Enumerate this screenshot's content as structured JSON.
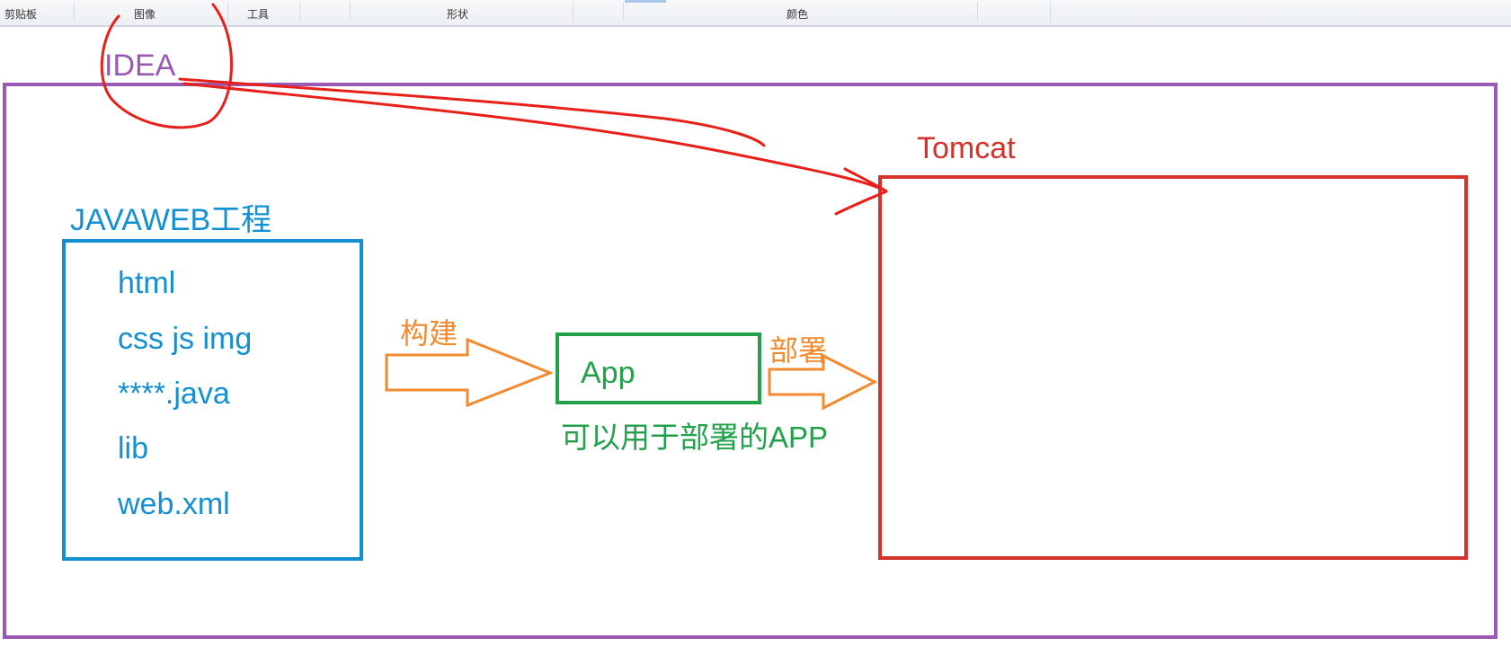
{
  "toolbar": {
    "groups": [
      {
        "label": "剪贴板"
      },
      {
        "label": "图像"
      },
      {
        "label": "工具"
      },
      {
        "label": "形状"
      },
      {
        "label": "颜色"
      }
    ]
  },
  "diagram": {
    "ide_label": "IDEA",
    "server_label": "Tomcat",
    "project": {
      "title": "JAVAWEB工程",
      "items": [
        "html",
        "css js img",
        "****.java",
        "lib",
        "web.xml"
      ]
    },
    "build_label": "构建",
    "artifact": {
      "label": "App",
      "caption": "可以用于部署的APP"
    },
    "deploy_label": "部署"
  },
  "colors": {
    "ide_frame": "#9b59b6",
    "project_box": "#1390d2",
    "artifact_box": "#22a04a",
    "server_box": "#d6312a",
    "arrow": "#f28a30",
    "annotation": "#e8201a"
  }
}
